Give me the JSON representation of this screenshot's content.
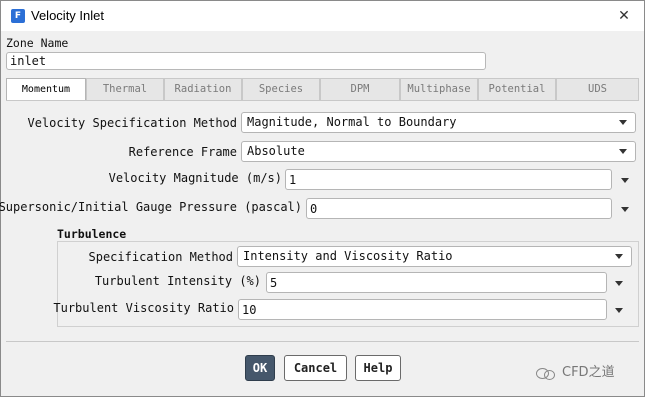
{
  "window": {
    "title": "Velocity Inlet",
    "app_icon": "F",
    "close": "✕"
  },
  "zone": {
    "label": "Zone Name",
    "value": "inlet"
  },
  "tabs": [
    {
      "label": "Momentum",
      "active": true
    },
    {
      "label": "Thermal"
    },
    {
      "label": "Radiation"
    },
    {
      "label": "Species"
    },
    {
      "label": "DPM"
    },
    {
      "label": "Multiphase"
    },
    {
      "label": "Potential"
    },
    {
      "label": "UDS"
    }
  ],
  "momentum": {
    "velocity_spec_method": {
      "label": "Velocity Specification Method",
      "value": "Magnitude, Normal to Boundary"
    },
    "reference_frame": {
      "label": "Reference Frame",
      "value": "Absolute"
    },
    "velocity_magnitude": {
      "label": "Velocity Magnitude (m/s)",
      "value": "1"
    },
    "gauge_pressure": {
      "label": "Supersonic/Initial Gauge Pressure (pascal)",
      "value": "0"
    }
  },
  "turbulence": {
    "title": "Turbulence",
    "spec_method": {
      "label": "Specification Method",
      "value": "Intensity and Viscosity Ratio"
    },
    "intensity": {
      "label": "Turbulent Intensity (%)",
      "value": "5"
    },
    "viscosity_ratio": {
      "label": "Turbulent Viscosity Ratio",
      "value": "10"
    }
  },
  "buttons": {
    "ok": "OK",
    "cancel": "Cancel",
    "help": "Help"
  },
  "watermark": {
    "text": "CFD之道",
    "icon": "wechat-icon"
  },
  "colors": {
    "accent": "#2b6fd6",
    "ok_button": "#45576b"
  }
}
